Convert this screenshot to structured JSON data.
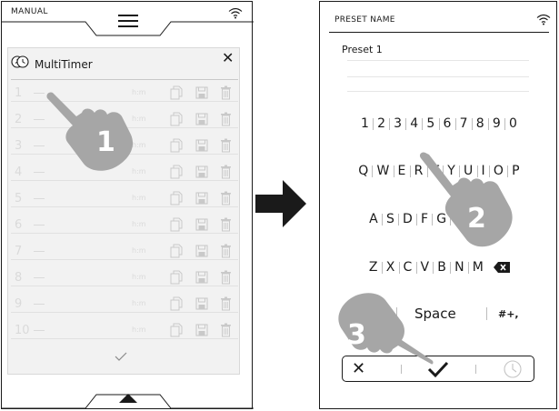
{
  "left_screen": {
    "mode_label": "MANUAL",
    "icons": {
      "menu": "hamburger-icon",
      "wifi": "wifi-icon",
      "up": "triangle-up-icon"
    },
    "multitimer": {
      "title": "MultiTimer",
      "close_label": "✕",
      "rows": [
        {
          "num": "1",
          "time": "h:m"
        },
        {
          "num": "2",
          "time": "h:m"
        },
        {
          "num": "3",
          "time": "h:m"
        },
        {
          "num": "4",
          "time": "h:m"
        },
        {
          "num": "5",
          "time": "h:m"
        },
        {
          "num": "6",
          "time": "h:m"
        },
        {
          "num": "7",
          "time": "h:m"
        },
        {
          "num": "8",
          "time": "h:m"
        },
        {
          "num": "9",
          "time": "h:m"
        },
        {
          "num": "10",
          "time": "h:m"
        }
      ],
      "row_icons": [
        "copy-icon",
        "save-icon",
        "trash-icon"
      ]
    },
    "step_badge": "1"
  },
  "right_screen": {
    "header": "PRESET NAME",
    "preset_value": "Preset 1",
    "keyboard": {
      "row_numbers": [
        "1",
        "2",
        "3",
        "4",
        "5",
        "6",
        "7",
        "8",
        "9",
        "0"
      ],
      "row_q": [
        "Q",
        "W",
        "E",
        "R",
        "T",
        "Y",
        "U",
        "I",
        "O",
        "P"
      ],
      "row_a": [
        "A",
        "S",
        "D",
        "F",
        "G",
        "H",
        "J",
        "K",
        "L"
      ],
      "row_z": [
        "Z",
        "X",
        "C",
        "V",
        "B",
        "N",
        "M"
      ],
      "backspace": "backspace-icon",
      "space": "Space",
      "symbols": "#+,"
    },
    "actions": {
      "cancel": "✕",
      "confirm": "check-icon",
      "timer": "clock-icon"
    },
    "step_badges": [
      "2",
      "3"
    ]
  },
  "colors": {
    "ink": "#1a1a1a",
    "hand_fill": "#a6a6a6",
    "faded": "#dadada"
  }
}
